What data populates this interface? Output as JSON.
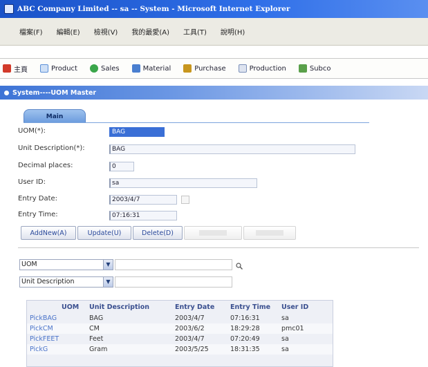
{
  "window": {
    "title": "ABC Company Limited -- sa -- System - Microsoft Internet Explorer"
  },
  "menu": [
    "檔案(F)",
    "編輯(E)",
    "檢視(V)",
    "我的最愛(A)",
    "工具(T)",
    "說明(H)"
  ],
  "modules": [
    {
      "label": "主頁",
      "icon": "home-icon",
      "color": "#d23a2a"
    },
    {
      "label": "Product",
      "icon": "product-icon",
      "color": "#5a8fd8"
    },
    {
      "label": "Sales",
      "icon": "sales-icon",
      "color": "#3aa64a"
    },
    {
      "label": "Material",
      "icon": "material-icon",
      "color": "#4a7fd0"
    },
    {
      "label": "Purchase",
      "icon": "purchase-icon",
      "color": "#c8961e"
    },
    {
      "label": "Production",
      "icon": "production-icon",
      "color": "#7a8fb8"
    },
    {
      "label": "Subco",
      "icon": "subcontract-icon",
      "color": "#5aa04a"
    }
  ],
  "section": {
    "title": "System----UOM Master"
  },
  "tab": {
    "label": "Main"
  },
  "form": {
    "uom_label": "UOM(*):",
    "uom_value": "BAG",
    "desc_label": "Unit Description(*):",
    "desc_value": "BAG",
    "decimal_label": "Decimal places:",
    "decimal_value": "0",
    "user_label": "User ID:",
    "user_value": "sa",
    "entry_date_label": "Entry Date:",
    "entry_date_value": "2003/4/7",
    "entry_time_label": "Entry Time:",
    "entry_time_value": "07:16:31"
  },
  "buttons": {
    "addnew": "AddNew(A)",
    "update": "Update(U)",
    "delete": "Delete(D)"
  },
  "search": {
    "field1": "UOM",
    "field2": "Unit Description"
  },
  "grid": {
    "columns": [
      "UOM",
      "Unit Description",
      "Entry Date",
      "Entry Time",
      "User ID"
    ],
    "pick_label": "Pick",
    "rows": [
      {
        "uom": "BAG",
        "desc": "BAG",
        "date": "2003/4/7",
        "time": "07:16:31",
        "user": "sa"
      },
      {
        "uom": "CM",
        "desc": "CM",
        "date": "2003/6/2",
        "time": "18:29:28",
        "user": "pmc01"
      },
      {
        "uom": "FEET",
        "desc": "Feet",
        "date": "2003/4/7",
        "time": "07:20:49",
        "user": "sa"
      },
      {
        "uom": "G",
        "desc": "Gram",
        "date": "2003/5/25",
        "time": "18:31:35",
        "user": "sa"
      }
    ]
  }
}
